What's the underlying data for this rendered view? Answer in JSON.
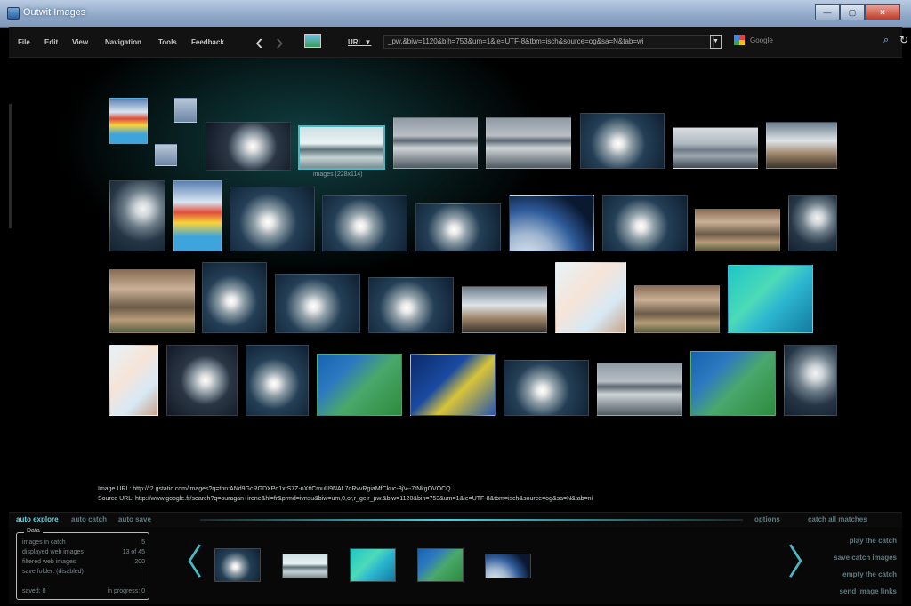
{
  "window": {
    "title": "Outwit Images",
    "controls": [
      "—",
      "▢",
      "✕"
    ]
  },
  "menu": {
    "items": [
      "File",
      "Edit",
      "View",
      "Navigation",
      "Tools",
      "Feedback"
    ]
  },
  "toolbar": {
    "url_label": "URL ▼",
    "url_value": "_pw.&biw=1120&bih=753&um=1&ie=UTF-8&tbm=isch&source=og&sa=N&tab=wi",
    "search_engine": "Google",
    "back": "‹",
    "forward": "›",
    "url_dropdown": "▼",
    "search_icon": "⌕",
    "refresh_icon": "↻"
  },
  "viewer": {
    "selected_caption": "images (228x114)",
    "image_url": "Image URL: http://t2.gstatic.com/images?q=tbn:ANd9GcRGDXPq1xtS7Z-nXttCmuU9NAL7oRvvRgiaMfCkuc-3jV--7tNkgOVOCQ",
    "source_url": "Source URL: http://www.google.fr/search?q=ouragan+irene&hl=fr&prmd=ivnsu&biw=um,0,or,r_gc.r_pw.&biw=1120&bih=753&um=1&ie=UTF-8&tbm=isch&source=og&sa=N&tab=ni"
  },
  "controls": {
    "auto_explore": "auto explore",
    "auto_catch": "auto catch",
    "auto_save": "auto save",
    "options": "options",
    "catch_all": "catch all matches"
  },
  "stats": {
    "legend": "Data",
    "rows": [
      {
        "label": "images in catch",
        "value": "5"
      },
      {
        "label": "displayed web images",
        "value": "13 of 45"
      },
      {
        "label": "filtered web images",
        "value": "200"
      },
      {
        "label": "save folder:",
        "value": "(disabled)"
      }
    ],
    "saved": "saved: 0",
    "in_progress": "in progress: 0"
  },
  "catch_nav": {
    "prev": "〈",
    "next": "〉"
  },
  "actions": [
    "play the catch",
    "save catch images",
    "empty the catch",
    "send image links"
  ]
}
